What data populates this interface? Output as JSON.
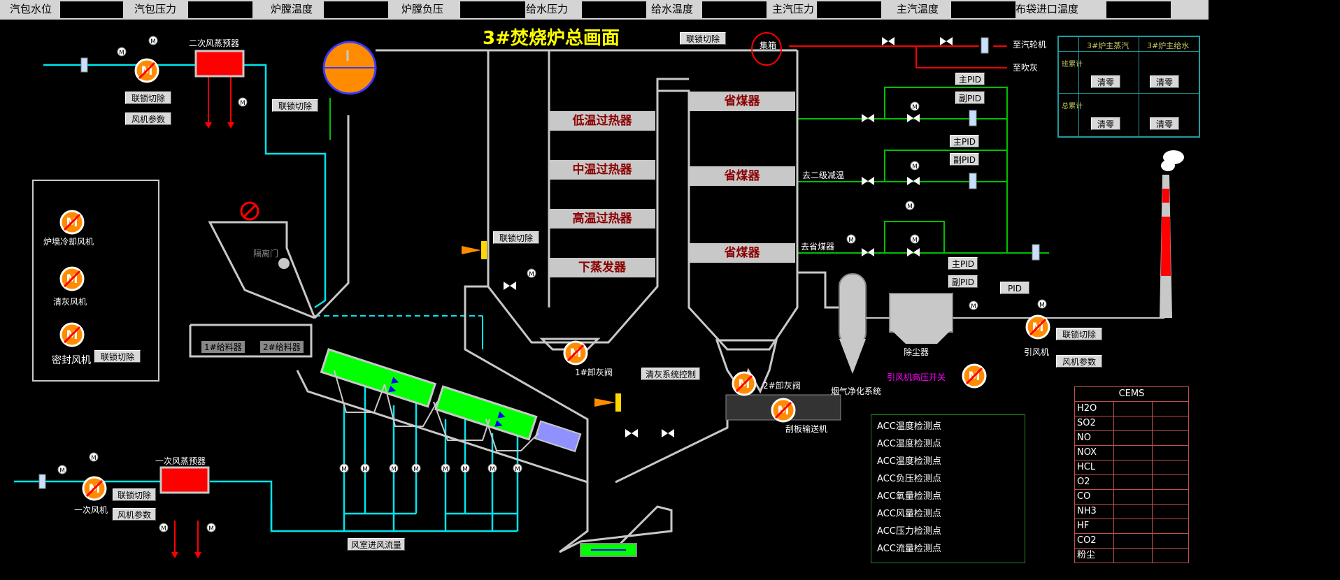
{
  "topbar": [
    {
      "label": "汽包水位"
    },
    {
      "label": "汽包压力"
    },
    {
      "label": "炉膛温度"
    },
    {
      "label": "炉膛负压"
    },
    {
      "label": "给水压力"
    },
    {
      "label": "给水温度"
    },
    {
      "label": "主汽压力"
    },
    {
      "label": "主汽温度"
    },
    {
      "label": "布袋进口温度"
    }
  ],
  "title": "3#焚烧炉总画面",
  "sections": {
    "low_sh": "低温过热器",
    "mid_sh": "中温过热器",
    "high_sh": "高温过热器",
    "evap": "下蒸发器",
    "econ1": "省煤器",
    "econ2": "省煤器",
    "econ3": "省煤器"
  },
  "labels": {
    "secondary_preheater": "二次风蒸预器",
    "primary_preheater": "一次风蒸预器",
    "primary_fan": "一次风机",
    "furnace_wall_fan": "炉墙冷却风机",
    "ash_fan": "清灰风机",
    "seal_fan": "密封风机",
    "isolation_door": "隔离门",
    "feeder1": "1#给料器",
    "feeder2": "2#给料器",
    "ash_valve1": "1#卸灰阀",
    "ash_valve2": "2#卸灰阀",
    "scraper": "刮板输送机",
    "flue_gas": "烟气净化系统",
    "dust": "除尘器",
    "id_fan": "引风机",
    "id_fan_switch": "引风机高压开关",
    "header": "集箱",
    "to_turbine": "至汽轮机",
    "to_soot": "至吹灰",
    "to_second_desuper": "去二级减温",
    "to_econ": "去省煤器",
    "motor": "M"
  },
  "buttons": {
    "interlock": "联锁切除",
    "fan_params": "风机参数",
    "main_pid": "主PID",
    "sub_pid": "副PID",
    "pid": "PID",
    "ash_control": "清灰系统控制",
    "air_flow": "风室进风流量",
    "clear": "清零"
  },
  "tally": {
    "col1": "3#炉主蒸汽",
    "col2": "3#炉主给水",
    "row1": "班累计",
    "row2": "总累计"
  },
  "acc_points": [
    "ACC温度检测点",
    "ACC温度检测点",
    "ACC温度检测点",
    "ACC负压检测点",
    "ACC氧量检测点",
    "ACC风量检测点",
    "ACC压力检测点",
    "ACC流量检测点"
  ],
  "cems": {
    "title": "CEMS",
    "rows": [
      "H2O",
      "SO2",
      "NO",
      "NOX",
      "HCL",
      "O2",
      "CO",
      "NH3",
      "HF",
      "CO2",
      "粉尘"
    ]
  },
  "colors": {
    "title": "#ffff00",
    "water_pipe": "#00e5ee",
    "steam_pipe": "#ff0000",
    "feed_pipe": "#00c000",
    "grate": "#00ff00",
    "section_text": "#8b0000",
    "magenta_label": "#ff00ff"
  }
}
